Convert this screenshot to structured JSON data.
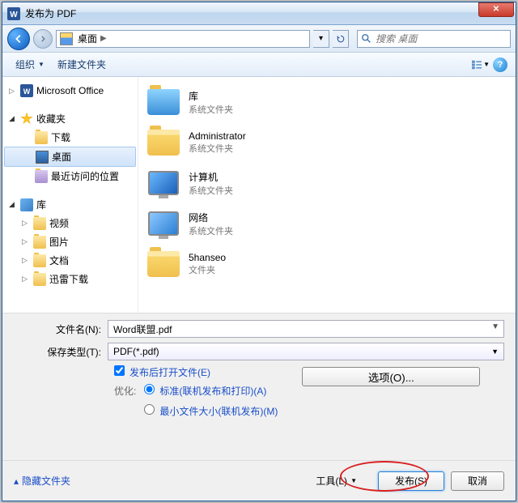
{
  "titlebar": {
    "title": "发布为 PDF"
  },
  "navbar": {
    "location_label": "桌面",
    "search_placeholder": "搜索 桌面"
  },
  "toolbar": {
    "organize": "组织",
    "new_folder": "新建文件夹"
  },
  "sidebar": {
    "ms_office": "Microsoft Office",
    "favorites": "收藏夹",
    "downloads": "下载",
    "desktop": "桌面",
    "recent": "最近访问的位置",
    "library": "库",
    "videos": "视频",
    "pictures": "图片",
    "documents": "文档",
    "xunlei": "迅雷下载"
  },
  "filelist": {
    "items": [
      {
        "name": "库",
        "type": "系统文件夹",
        "kind": "lib"
      },
      {
        "name": "Administrator",
        "type": "系统文件夹",
        "kind": "user"
      },
      {
        "name": "计算机",
        "type": "系统文件夹",
        "kind": "computer"
      },
      {
        "name": "网络",
        "type": "系统文件夹",
        "kind": "network"
      },
      {
        "name": "5hanseo",
        "type": "文件夹",
        "kind": "folder"
      }
    ]
  },
  "form": {
    "filename_label": "文件名(N):",
    "filename_value": "Word联盟.pdf",
    "filetype_label": "保存类型(T):",
    "filetype_value": "PDF(*.pdf)",
    "open_after_label": "发布后打开文件(E)",
    "optimize_label": "优化:",
    "opt_standard": "标准(联机发布和打印)(A)",
    "opt_minsize": "最小文件大小(联机发布)(M)",
    "options_btn": "选项(O)..."
  },
  "footer": {
    "hide_folders": "隐藏文件夹",
    "tools": "工具(L)",
    "publish": "发布(S)",
    "cancel": "取消"
  }
}
